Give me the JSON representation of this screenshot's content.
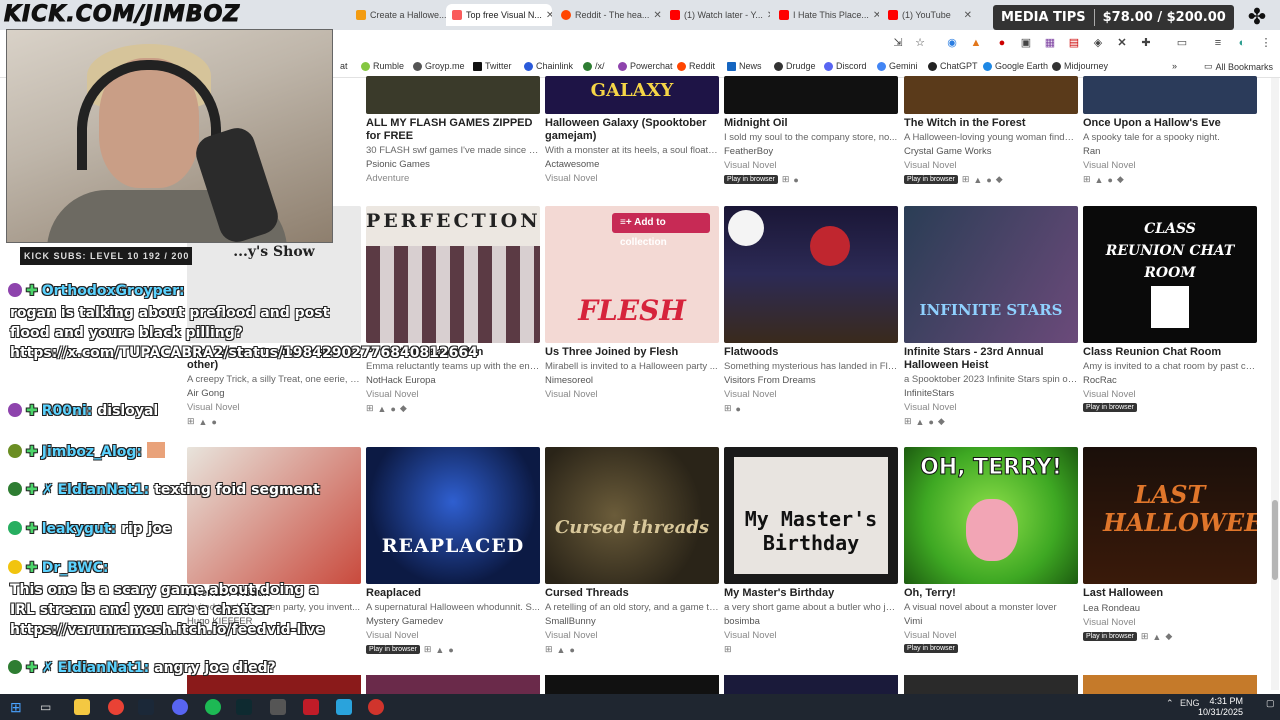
{
  "stream": {
    "channel": "KICK.COM/JIMBOZ",
    "subs_goal": "KICK SUBS: LEVEL 10 192 / 200",
    "media_tips_label": "MEDIA TIPS",
    "media_tips_amount": "$78.00 / $200.00"
  },
  "browser": {
    "tabs": [
      {
        "label": "Create a Hallowe...",
        "color": "#f39c12"
      },
      {
        "label": "Top free Visual N...",
        "color": "#fa5c5c"
      },
      {
        "label": "Reddit - The hea...",
        "color": "#ff4500"
      },
      {
        "label": "(1) Watch later - Y...",
        "color": "#ff0000"
      },
      {
        "label": "I Hate This Place...",
        "color": "#ff0000"
      },
      {
        "label": "(1) YouTube",
        "color": "#ff0000"
      }
    ],
    "bookmarks": [
      {
        "label": "at",
        "color": "#999"
      },
      {
        "label": "Rumble",
        "color": "#85c742"
      },
      {
        "label": "Groyp.me",
        "color": "#555"
      },
      {
        "label": "Twitter",
        "color": "#111"
      },
      {
        "label": "Chainlink",
        "color": "#2a5ada"
      },
      {
        "label": "/x/",
        "color": "#2e7d32"
      },
      {
        "label": "Powerchat",
        "color": "#8e44ad"
      },
      {
        "label": "Reddit",
        "color": "#ff4500"
      },
      {
        "label": "News",
        "color": "#1565c0"
      },
      {
        "label": "Drudge",
        "color": "#333"
      },
      {
        "label": "Discord",
        "color": "#5865f2"
      },
      {
        "label": "Gemini",
        "color": "#4285f4"
      },
      {
        "label": "ChatGPT",
        "color": "#222"
      },
      {
        "label": "Google Earth",
        "color": "#1e88e5"
      },
      {
        "label": "Midjourney",
        "color": "#333"
      }
    ],
    "all_bookmarks": "All Bookmarks"
  },
  "chat": {
    "messages": [
      {
        "user": "OrthodoxGroyper:",
        "badge_color": "#8e44ad",
        "text": "rogan is talking about preflood and post flood and youre black pilling? https://x.com/TUPACABRA2/status/19842902776840812664"
      },
      {
        "user": "R00ni:",
        "badge_color": "#8e44ad",
        "text": "disloyal"
      },
      {
        "user": "Jimboz_Alog:",
        "badge_color": "#6b8e23",
        "text": ""
      },
      {
        "user": "EldianNat1:",
        "badge_color": "#2e7d32",
        "text": "texting foid segment"
      },
      {
        "user": "leakygut:",
        "badge_color": "#27ae60",
        "text": "rip joe"
      },
      {
        "user": "Dr_BWC:",
        "badge_color": "#f1c40f",
        "text": "This one is a scary game about doing a IRL stream and you are a chatter https://varunramesh.itch.io/feedvid-live"
      },
      {
        "user": "EldianNat1:",
        "badge_color": "#2e7d32",
        "text": "angry joe died?"
      }
    ]
  },
  "page": {
    "add_to_collection": "Add to collection",
    "play_in_browser": "Play in browser",
    "games": [
      {
        "title": "ALL MY FLASH GAMES ZIPPED for FREE",
        "desc": "30 FLASH swf games I've made since 20...",
        "author": "Psionic Games",
        "genre": "Adventure",
        "thumb": "#3a3a2a",
        "thumb_text": ""
      },
      {
        "title": "Halloween Galaxy (Spooktober gamejam)",
        "desc": "With a monster at its heels, a soul floats ...",
        "author": "Actawesome",
        "genre": "Visual Novel",
        "thumb": "#1e1446",
        "thumb_text": "GALAXY"
      },
      {
        "title": "Midnight Oil",
        "desc": "I sold my soul to the company store, no...",
        "author": "FeatherBoy",
        "genre": "Visual Novel",
        "thumb": "#111111",
        "thumb_text": ""
      },
      {
        "title": "The Witch in the Forest",
        "desc": "A Halloween-loving young woman finds ...",
        "author": "Crystal Game Works",
        "genre": "Visual Novel",
        "thumb": "#5a3a1a",
        "thumb_text": ""
      },
      {
        "title": "Once Upon a Hallow's Eve",
        "desc": "A spooky tale for a spooky night.",
        "author": "Ran",
        "genre": "Visual Novel",
        "thumb": "#2b3b5a",
        "thumb_text": ""
      },
      {
        "title": "Trick or Treat Creators (and one other)",
        "desc": "A creepy Trick, a silly Treat, one eerie, on...",
        "author": "Air Gong",
        "genre": "Visual Novel",
        "thumb": "#e9e9e9",
        "thumb_text": "...y's Show"
      },
      {
        "title": "Perfection | Paper-thin",
        "desc": "Emma reluctantly teams up with the ene...",
        "author": "NotHack Europa",
        "genre": "Visual Novel",
        "thumb": "#ece7e1",
        "thumb_text": "PERFECTION"
      },
      {
        "title": "Us Three Joined by Flesh",
        "desc": "Mirabell is invited to a Halloween party ...",
        "author": "Nimesoreol",
        "genre": "Visual Novel",
        "thumb": "#f3d9d4",
        "thumb_text": "FLESH"
      },
      {
        "title": "Flatwoods",
        "desc": "Something mysterious has landed in Flat...",
        "author": "Visitors From Dreams",
        "genre": "Visual Novel",
        "thumb": "#1a1636",
        "thumb_text": ""
      },
      {
        "title": "Infinite Stars - 23rd Annual Halloween Heist",
        "desc": "a Spooktober 2023 Infinite Stars spin off...",
        "author": "InfiniteStars",
        "genre": "Visual Novel",
        "thumb": "#3b2f52",
        "thumb_text": "INFINITE STARS"
      },
      {
        "title": "Class Reunion Chat Room",
        "desc": "Amy is invited to a chat room by past cla...",
        "author": "RocRac",
        "genre": "Visual Novel",
        "thumb": "#0a0a0a",
        "thumb_text": "CLASS REUNION CHAT ROOM"
      },
      {
        "title": "Friends? Redux",
        "desc": "Invited to a Halloween party, you invent...",
        "author": "Hugo KIEFFER",
        "genre": "",
        "thumb": "#e8e4dc",
        "thumb_text": ""
      },
      {
        "title": "Reaplaced",
        "desc": "A supernatural Halloween whodunnit. S...",
        "author": "Mystery Gamedev",
        "genre": "Visual Novel",
        "thumb": "#0c1a44",
        "thumb_text": "REAPLACED"
      },
      {
        "title": "Cursed Threads",
        "desc": "A retelling of an old story, and a game to...",
        "author": "SmallBunny",
        "genre": "Visual Novel",
        "thumb": "#2a2418",
        "thumb_text": "Cursed threads"
      },
      {
        "title": "My Master's Birthday",
        "desc": "a very short game about a butler who ju...",
        "author": "bosimba",
        "genre": "Visual Novel",
        "thumb": "#1a1a1a",
        "thumb_text": "My Master's Birthday"
      },
      {
        "title": "Oh, Terry!",
        "desc": "A visual novel about a monster lover",
        "author": "Vimi",
        "genre": "Visual Novel",
        "thumb": "#3ea823",
        "thumb_text": "OH, TERRY!"
      },
      {
        "title": "Last Halloween",
        "desc": "",
        "author": "Lea Rondeau",
        "genre": "Visual Novel",
        "thumb": "#1a0f0a",
        "thumb_text": "LAST HALLOWEEN"
      }
    ]
  },
  "taskbar": {
    "lang": "ENG",
    "time": "4:31 PM",
    "date": "10/31/2025"
  }
}
